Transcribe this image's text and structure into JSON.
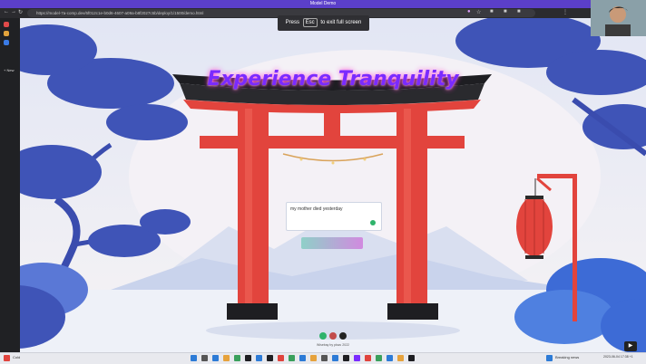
{
  "window": {
    "title": "Model Demo"
  },
  "browser": {
    "address": "https://model-7a-comp.dev/6f012c1e-b0d6-4607-a09a-b8f2027c5b/deploy/1/1500/demo.html",
    "new_tab_label": "New"
  },
  "banner": {
    "press": "Press",
    "key": "Esc",
    "suffix": "to exit full screen"
  },
  "page": {
    "headline": "Experience Tranquility",
    "input_value": "my mother died yesterday",
    "footer": "Wisebay by pkwu 2022"
  },
  "taskbar": {
    "weather": "Cold",
    "news": "Breaking news",
    "clock": "2023-06-04 17:38 +1"
  },
  "colors": {
    "accent": "#7a2bff",
    "glow": "#ff3fd0",
    "torii": "#e2443d",
    "tree_blue": "#3f54b7"
  }
}
